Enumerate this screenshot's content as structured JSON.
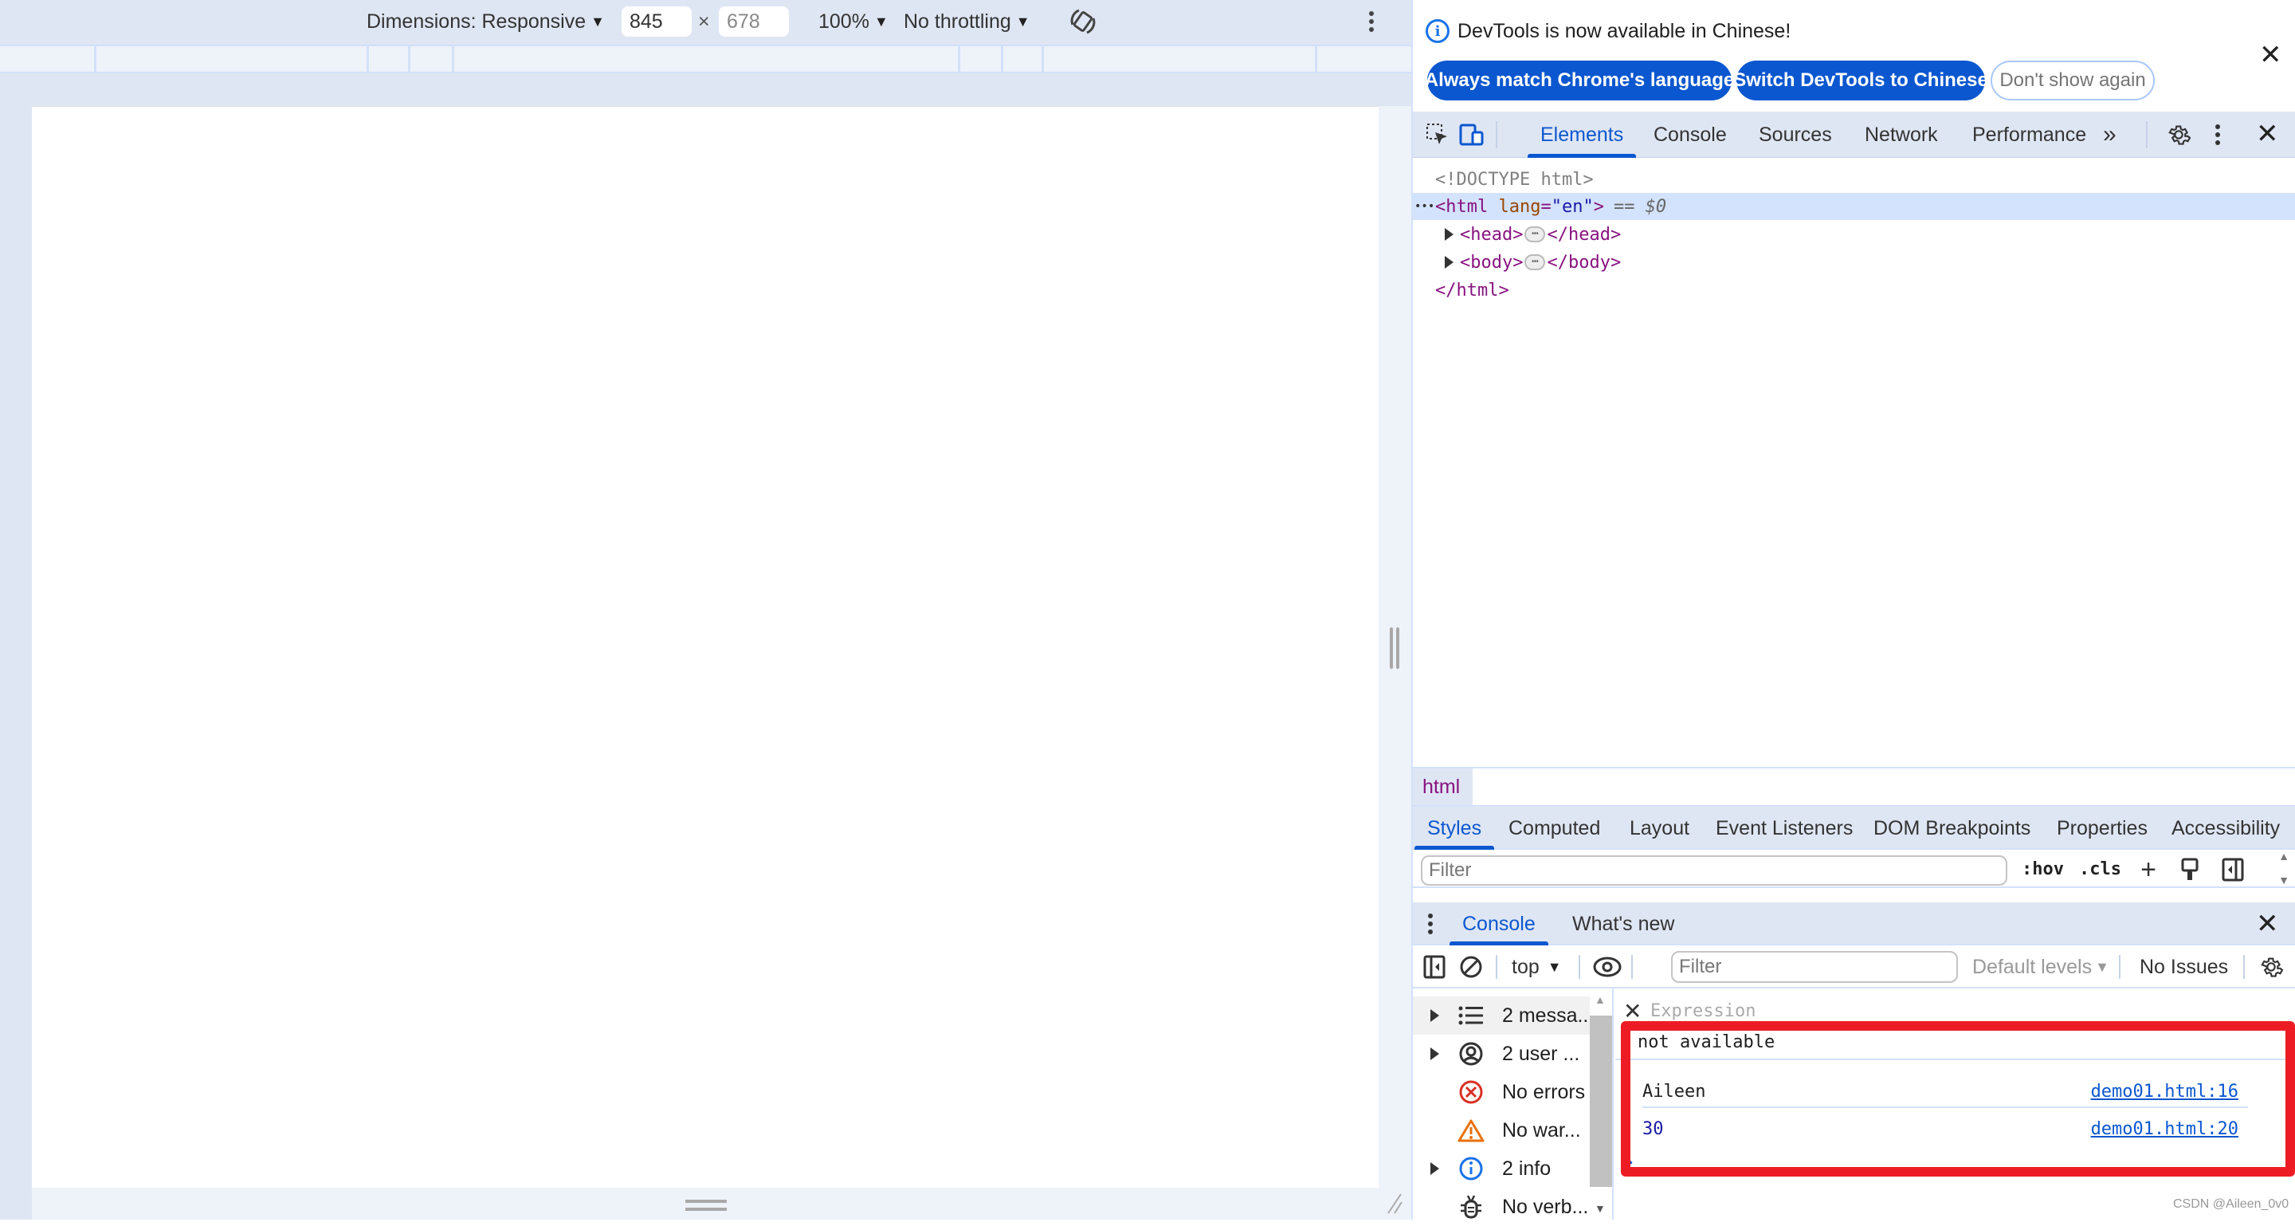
{
  "emulation": {
    "dimensions_label": "Dimensions: Responsive",
    "width_value": "845",
    "height_value": "678",
    "times_sign": "×",
    "zoom_label": "100%",
    "throttling_label": "No throttling",
    "rotate_icon": "rotate-icon",
    "more_icon": "more-vertical-icon"
  },
  "infobar": {
    "message": "DevTools is now available in Chinese!",
    "buttons": [
      "Always match Chrome's language",
      "Switch DevTools to Chinese",
      "Don't show again"
    ],
    "close_glyph": "✕"
  },
  "main_tabs": {
    "tabs": [
      "Elements",
      "Console",
      "Sources",
      "Network",
      "Performance"
    ],
    "active": "Elements",
    "overflow_glyph": "»"
  },
  "elements_tree": {
    "doctype": "<!DOCTYPE html>",
    "html_open_tag": "<html",
    "html_attr_name": "lang",
    "html_attr_eq": "=",
    "html_attr_value": "\"en\"",
    "html_open_close": ">",
    "selected_marker": "== $0",
    "head_open": "<head>",
    "head_close": "</head>",
    "body_open": "<body>",
    "body_close": "</body>",
    "html_close": "</html>",
    "ellipsis": "⋯",
    "gutter_dots": "•••"
  },
  "breadcrumb": {
    "items": [
      "html"
    ]
  },
  "styles_tabs": {
    "tabs": [
      "Styles",
      "Computed",
      "Layout",
      "Event Listeners",
      "DOM Breakpoints",
      "Properties",
      "Accessibility"
    ],
    "active": "Styles"
  },
  "styles_toolbar": {
    "filter_placeholder": "Filter",
    "hov_label": ":hov",
    "cls_label": ".cls"
  },
  "drawer": {
    "tabs": [
      "Console",
      "What's new"
    ],
    "active": "Console"
  },
  "console_toolbar": {
    "context": "top",
    "filter_placeholder": "Filter",
    "levels": "Default levels",
    "issues": "No Issues"
  },
  "console_sidebar": {
    "items": [
      {
        "label": "2 messa...",
        "icon": "list-icon",
        "expandable": true
      },
      {
        "label": "2 user ...",
        "icon": "user-icon",
        "expandable": true
      },
      {
        "label": "No errors",
        "icon": "error-icon",
        "expandable": false
      },
      {
        "label": "No war...",
        "icon": "warning-icon",
        "expandable": false
      },
      {
        "label": "2 info",
        "icon": "info-icon",
        "expandable": true
      },
      {
        "label": "No verb...",
        "icon": "bug-icon",
        "expandable": false
      }
    ]
  },
  "console_output": {
    "expression_placeholder": "Expression",
    "live_expression_value": "not available",
    "logs": [
      {
        "value": "Aileen",
        "source": "demo01.html:16",
        "type": "string"
      },
      {
        "value": "30",
        "source": "demo01.html:20",
        "type": "number"
      }
    ],
    "prompt_glyph": "›"
  },
  "colors": {
    "accent": "#0b57d0",
    "highlight_box": "#ed1c24",
    "panel_bg": "#dfe6f3"
  },
  "watermark": "CSDN @Aileen_0v0"
}
